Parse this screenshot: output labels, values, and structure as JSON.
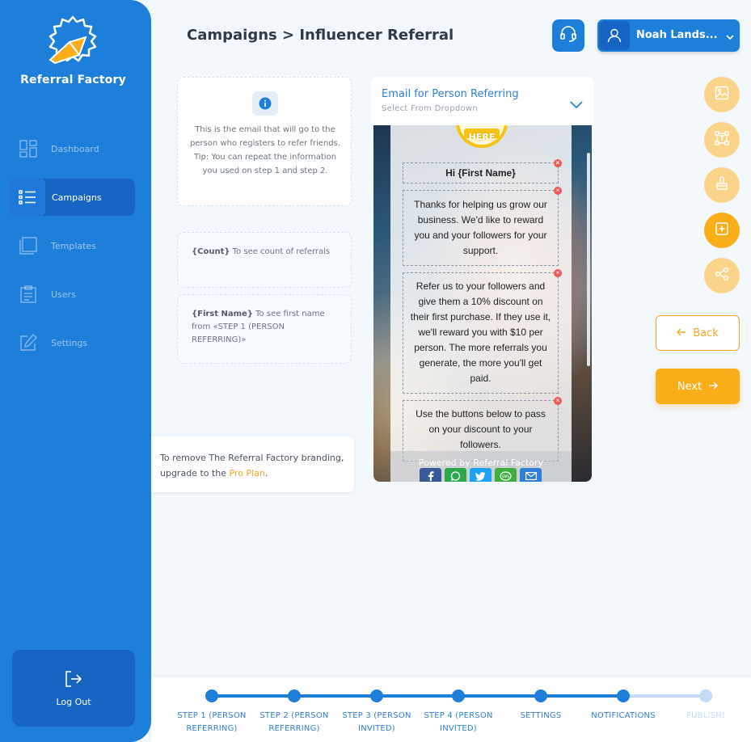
{
  "app": {
    "brand": "Referral Factory"
  },
  "sidebar": {
    "items": [
      {
        "label": "Dashboard",
        "icon": "dashboard-icon",
        "active": false
      },
      {
        "label": "Campaigns",
        "icon": "list-icon",
        "active": true
      },
      {
        "label": "Templates",
        "icon": "templates-icon",
        "active": false
      },
      {
        "label": "Users",
        "icon": "clipboard-icon",
        "active": false
      },
      {
        "label": "Settings",
        "icon": "edit-icon",
        "active": false
      }
    ],
    "logout_label": "Log Out"
  },
  "header": {
    "breadcrumb": "Campaigns > Influencer Referral",
    "user_name": "Noah Lands..."
  },
  "info": {
    "text": "This is the email that will go to the person who registers to refer friends. Tip: You can repeat the information you used on step 1 and step 2.",
    "tips": [
      {
        "token": "{Count}",
        "text": " To see count of referrals"
      },
      {
        "token": "{First Name}",
        "text": " To see first name from «STEP 1 (PERSON REFERRING)»"
      }
    ]
  },
  "upgrade": {
    "text": "To remove The Referral Factory branding, upgrade to the ",
    "link": "Pro Plan",
    "suffix": "."
  },
  "email_select": {
    "title": "Email for Person Referring",
    "subtitle": "Select From Dropdown"
  },
  "email": {
    "badge": "HERE",
    "blocks": [
      "Hi {First Name}",
      "Thanks for helping us grow our business. We'd like to reward you and your followers for your support.",
      "Refer us to your followers and give them a 10% discount on their first purchase. If they use it, we'll reward you with $10 per person. The more referrals you generate, the more you'll get paid.",
      "Use the buttons below to pass on your discount to your followers."
    ],
    "powered_by": "Powered by  Referral Factory",
    "share_buttons": [
      {
        "icon": "facebook-icon",
        "color": "#3b5998"
      },
      {
        "icon": "whatsapp-icon",
        "color": "#2aa84a"
      },
      {
        "icon": "twitter-icon",
        "color": "#1da1f2"
      },
      {
        "icon": "sms-icon",
        "color": "#3fae3f"
      },
      {
        "icon": "email-icon",
        "color": "#2f7fd6"
      }
    ]
  },
  "tools": [
    "image-icon",
    "crop-icon",
    "paint-icon",
    "add-block-icon",
    "share-icon"
  ],
  "actions": {
    "back": "Back",
    "next": "Next"
  },
  "steps": [
    {
      "label": "STEP 1 (PERSON REFERRING)",
      "done": true
    },
    {
      "label": "STEP 2 (PERSON REFERRING)",
      "done": true
    },
    {
      "label": "STEP 3 (PERSON INVITED)",
      "done": true
    },
    {
      "label": "STEP 4 (PERSON INVITED)",
      "done": true
    },
    {
      "label": "SETTINGS",
      "done": true
    },
    {
      "label": "NOTIFICATIONS",
      "done": true
    },
    {
      "label": "PUBLISH!",
      "done": false
    }
  ],
  "colors": {
    "primary": "#1e7fdb",
    "sidebar_dark": "#1765c3",
    "accent": "#f9ae1a",
    "accent_light": "#fad48a"
  }
}
